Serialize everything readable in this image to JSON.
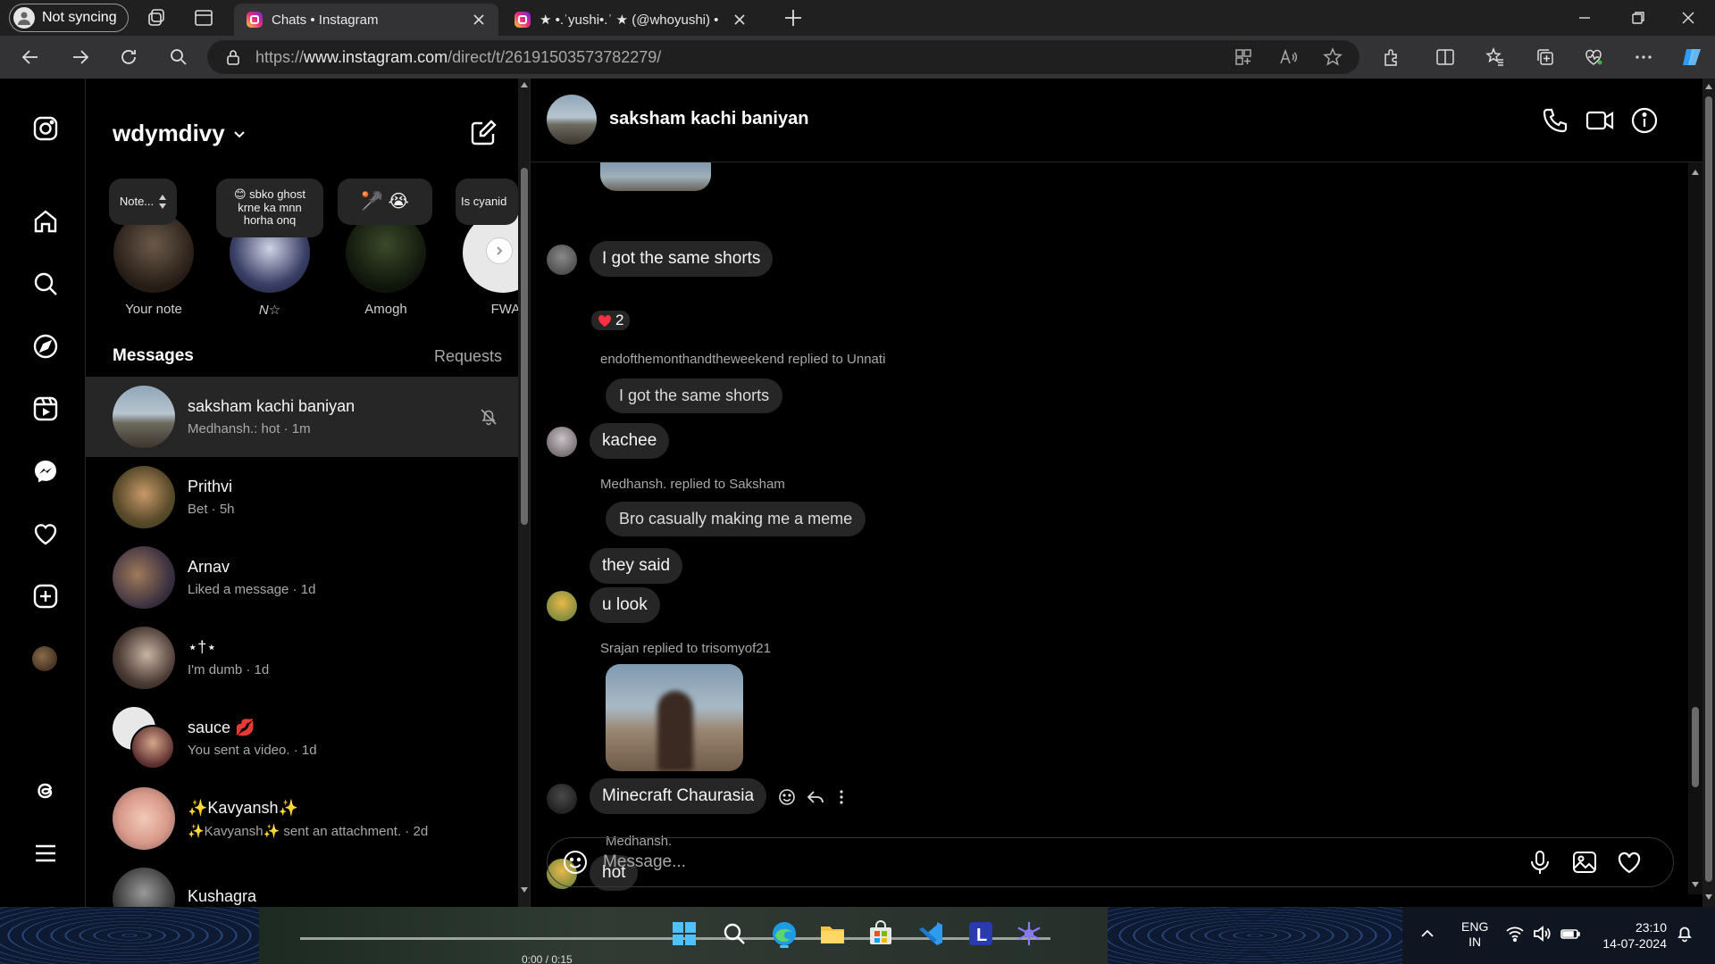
{
  "browser": {
    "sync_label": "Not syncing",
    "tabs": [
      {
        "title": "Chats • Instagram",
        "active": true
      },
      {
        "title": "★ •.ʾyushi•.ʾ ★ (@whoyushi) • Ir",
        "active": false
      }
    ],
    "url_prefix": "https://",
    "url_host": "www.instagram.com",
    "url_path": "/direct/t/26191503573782279/"
  },
  "inbox": {
    "username": "wdymdivy",
    "notes": [
      {
        "note": "Note...",
        "name": "Your note"
      },
      {
        "note": "😊 sbko ghost krne ka mnn horha onq",
        "name": "N☆"
      },
      {
        "note": "🥍 😭",
        "name": "Amogh"
      },
      {
        "note": "Is cyanid",
        "name": "FWA"
      }
    ],
    "tab_messages": "Messages",
    "tab_requests": "Requests",
    "conversations": [
      {
        "name": "saksham kachi baniyan",
        "sub": "Medhansh.: hot · 1m"
      },
      {
        "name": "Prithvi",
        "sub": "Bet · 5h"
      },
      {
        "name": "Arnav",
        "sub": "Liked a message · 1d"
      },
      {
        "name": "⋆†⋆",
        "sub": "I'm dumb · 1d"
      },
      {
        "name": "sauce 💋",
        "sub": "You sent a video. · 1d"
      },
      {
        "name": "✨Kavyansh✨",
        "sub": "✨Kavyansh✨ sent an attachment. · 2d"
      },
      {
        "name": "Kushagra",
        "sub": ""
      }
    ]
  },
  "chat": {
    "title": "saksham kachi baniyan",
    "messages": {
      "m1": "I got the same shorts",
      "reaction": "2",
      "reply1_label": "endofthemonthandtheweekend replied to Unnati",
      "reply1_quote": "I got the same shorts",
      "m2": "kachee",
      "reply2_label": "Medhansh. replied to Saksham",
      "reply2_quote": "Bro casually making me a meme",
      "m3": "they said",
      "m4": "u look",
      "reply3_label": "Srajan replied to trisomyof21",
      "m5": "Minecraft Chaurasia",
      "sender_label": "Medhansh.",
      "m6": "hot"
    },
    "composer_placeholder": "Message..."
  },
  "taskbar": {
    "media_time": "0:00 / 0:15",
    "lang_top": "ENG",
    "lang_bottom": "IN",
    "time": "23:10",
    "date": "14-07-2024"
  },
  "colors": {
    "bubble": "#262626",
    "secondary_text": "#a8a8a8",
    "reaction_heart": "#ff3040"
  }
}
